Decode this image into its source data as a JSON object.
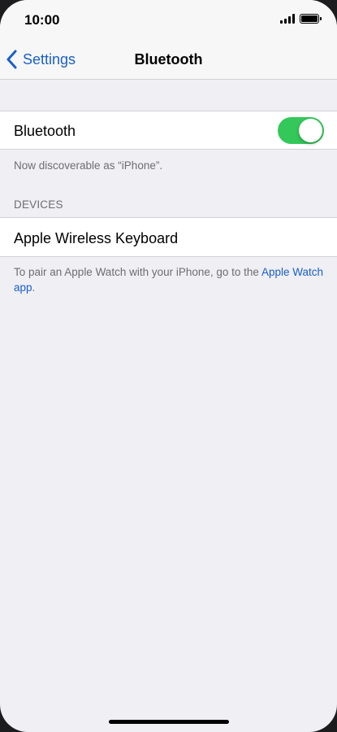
{
  "status_bar": {
    "time": "10:00",
    "signal_icon": "cellular-signal-icon",
    "battery_icon": "battery-icon"
  },
  "nav": {
    "back_label": "Settings",
    "back_icon": "chevron-left-icon",
    "title": "Bluetooth"
  },
  "bluetooth": {
    "label": "Bluetooth",
    "enabled": true,
    "discoverable_text": "Now discoverable as “iPhone”."
  },
  "devices": {
    "header": "DEVICES",
    "items": [
      {
        "name": "Apple Wireless Keyboard"
      }
    ]
  },
  "pair_note": {
    "text": "To pair an Apple Watch with your iPhone, go to the ",
    "link": "Apple Watch app",
    "suffix": "."
  },
  "colors": {
    "accent": "#1a5fc7",
    "toggle_on": "#34c759",
    "background": "#efeff4",
    "secondary_text": "#6d6d72"
  }
}
